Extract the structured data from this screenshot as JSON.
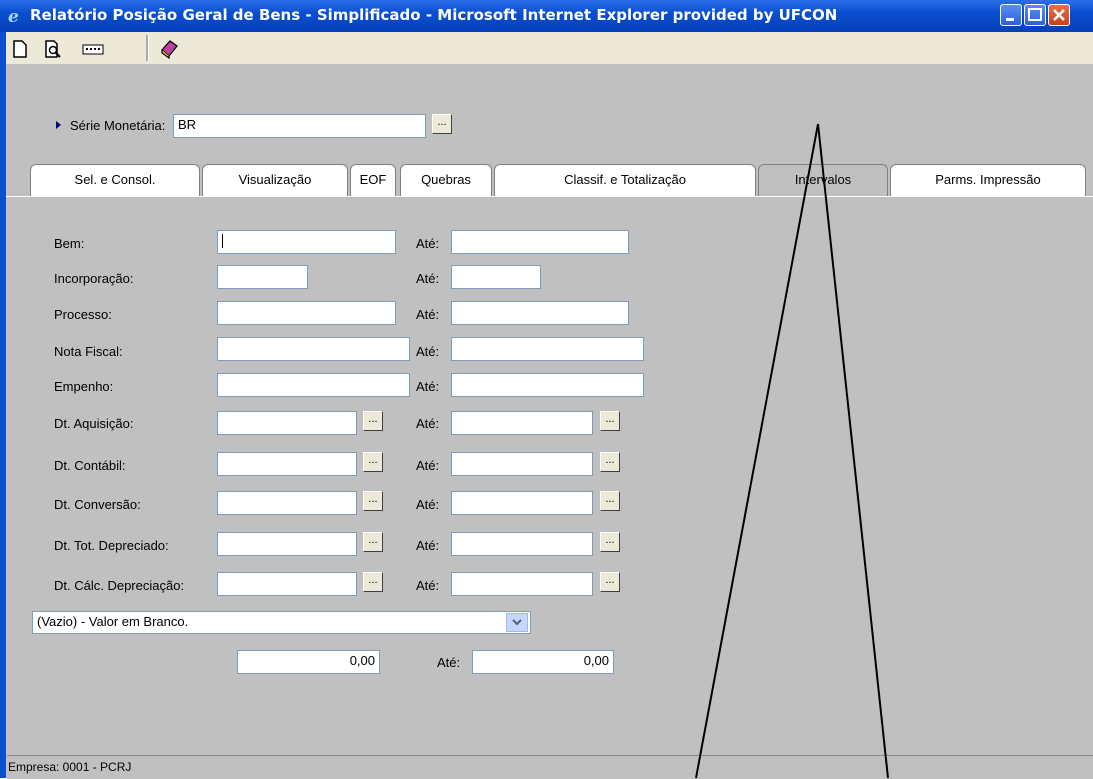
{
  "window": {
    "title": "Relatório Posição Geral de Bens - Simplificado - Microsoft Internet Explorer provided by UFCON"
  },
  "toolbar": {
    "icons": [
      "new-doc-icon",
      "print-preview-icon",
      "keyboard-icon",
      "book-icon"
    ]
  },
  "header": {
    "serie_label": "Série Monetária:",
    "serie_value": "BR",
    "ellipsis": "..."
  },
  "tabs": [
    {
      "label": "Sel. e Consol."
    },
    {
      "label": "Visualização"
    },
    {
      "label": "EOF"
    },
    {
      "label": "Quebras"
    },
    {
      "label": "Classif. e Totalização"
    },
    {
      "label": "Intervalos"
    },
    {
      "label": "Parms. Impressão"
    }
  ],
  "form": {
    "ate": "Até:",
    "ellipsis": "...",
    "rows": [
      {
        "label": "Bem:"
      },
      {
        "label": "Incorporação:"
      },
      {
        "label": "Processo:"
      },
      {
        "label": "Nota Fiscal:"
      },
      {
        "label": "Empenho:"
      },
      {
        "label": "Dt. Aquisição:"
      },
      {
        "label": "Dt. Contábil:"
      },
      {
        "label": "Dt. Conversão:"
      },
      {
        "label": "Dt. Tot. Depreciado:"
      },
      {
        "label": "Dt. Cálc. Depreciação:"
      }
    ],
    "select_value": "(Vazio) - Valor em Branco.",
    "value_from": "0,00",
    "value_to": "0,00"
  },
  "status": {
    "text": "Empresa: 0001 - PCRJ"
  }
}
